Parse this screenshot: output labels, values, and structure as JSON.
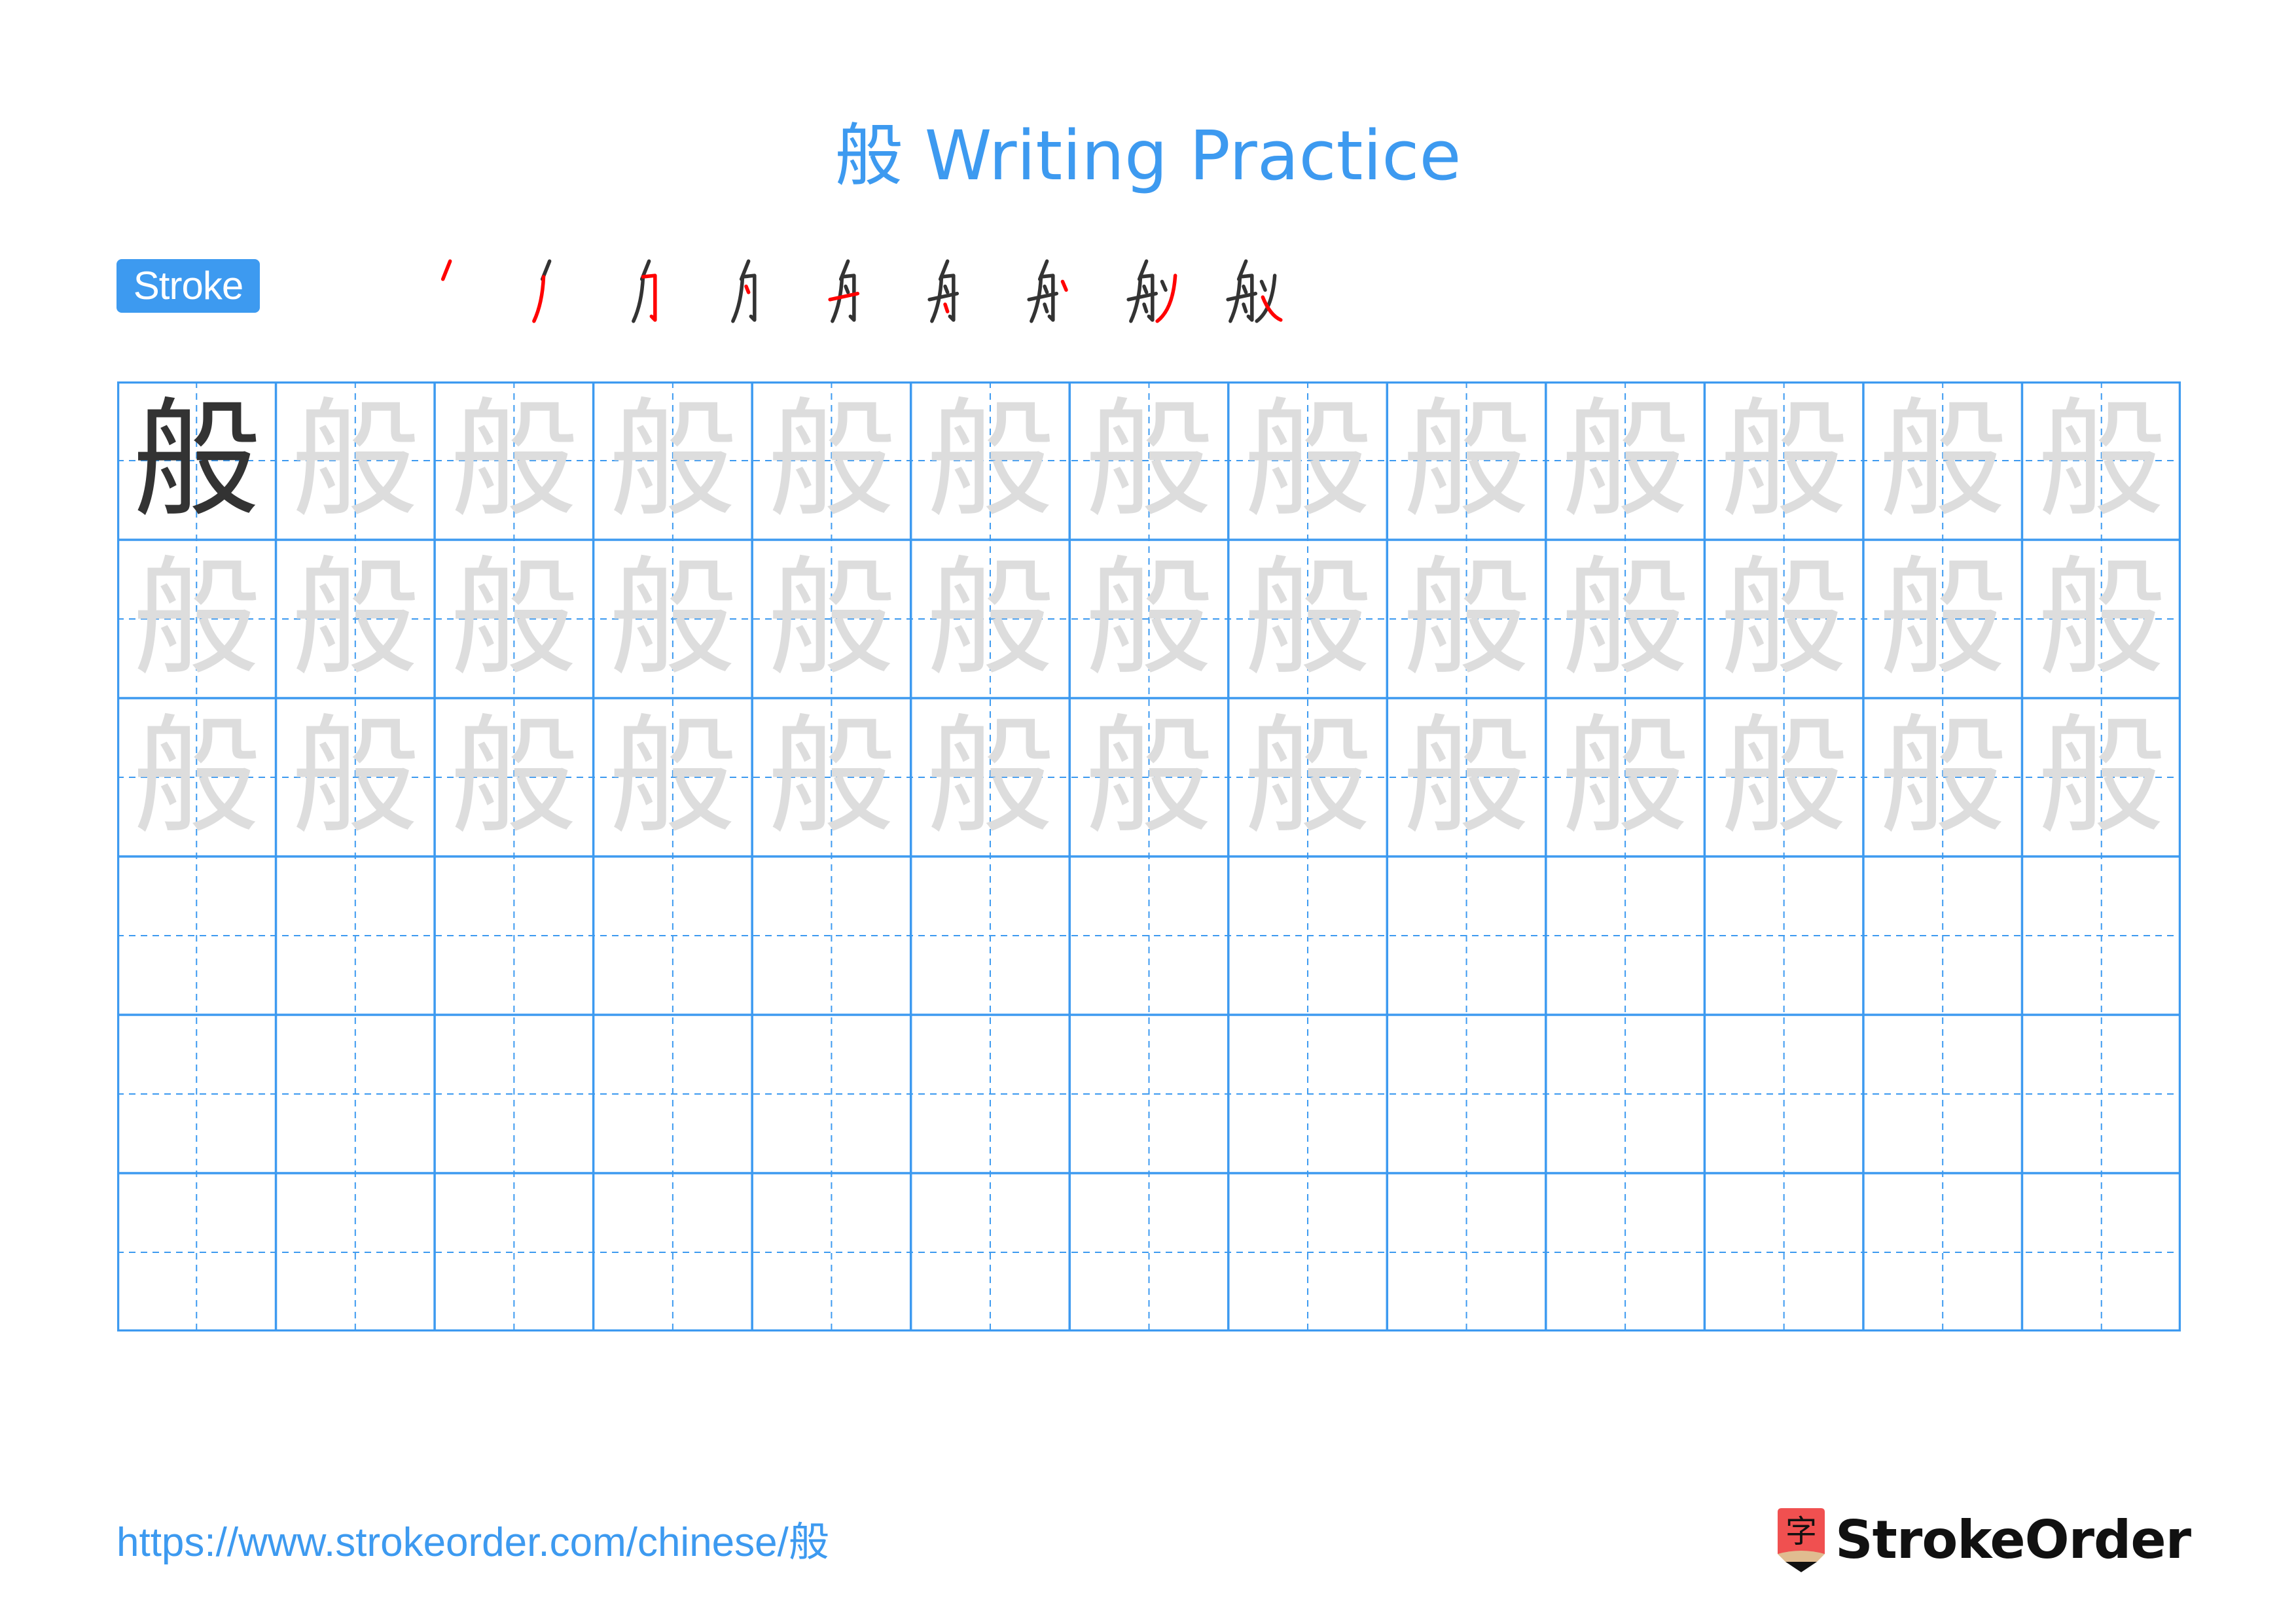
{
  "title": {
    "character": "般",
    "suffix": "Writing Practice"
  },
  "stroke_order": {
    "label": "Stroke Order",
    "step_count": 9,
    "colors": {
      "done": "#333333",
      "current": "#ff0000"
    }
  },
  "grid": {
    "rows": 6,
    "columns": 13,
    "character": "般",
    "model_cells": 1,
    "trace_rows": 3,
    "empty_rows": 3,
    "colors": {
      "line": "#3d9af0",
      "model": "#333333",
      "trace": "#dddddd"
    }
  },
  "footer": {
    "url": "https://www.strokeorder.com/chinese/般",
    "brand": "StrokeOrder",
    "logo_char": "字"
  }
}
